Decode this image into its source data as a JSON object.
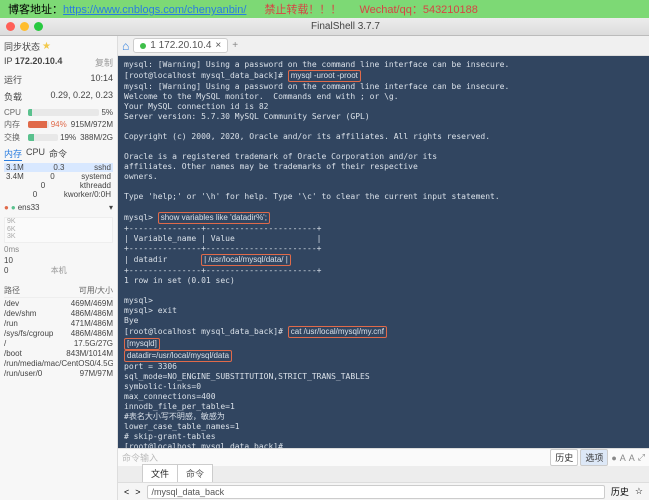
{
  "banner": {
    "blog_label": "博客地址：",
    "blog_url": "https://www.cnblogs.com/chenyanbin/",
    "warn": "禁止转载！！！",
    "contact_label": "Wechat/qq：",
    "contact_id": "543210188"
  },
  "title": "FinalShell 3.7.7",
  "sidebar": {
    "status_label": "同步状态",
    "ip_label": "IP",
    "ip": "172.20.10.4",
    "copy": "复制",
    "uptime_label": "运行",
    "uptime": "10:14",
    "load_label": "负载",
    "load": "0.29, 0.22, 0.23",
    "cpu_label": "CPU",
    "cpu_pct": "5%",
    "mem_label": "内存",
    "mem_pct": "94%",
    "mem_val": "915M/972M",
    "swap_label": "交换",
    "swap_pct": "19%",
    "swap_val": "388M/2G",
    "tabs": [
      "内存",
      "CPU",
      "命令"
    ],
    "procs": [
      {
        "mem": "3.1M",
        "pct": "0.3",
        "name": "sshd"
      },
      {
        "mem": "3.4M",
        "pct": "0",
        "name": "systemd"
      },
      {
        "mem": "",
        "pct": "0",
        "name": "kthreadd"
      },
      {
        "mem": "",
        "pct": "0",
        "name": "kworker/0:0H"
      }
    ],
    "net_iface": "ens33",
    "graph_y": [
      "9K",
      "9K",
      "6K",
      "3K"
    ],
    "graph_t": [
      "0ms",
      "10",
      "0"
    ],
    "local": "本机",
    "disk_header": [
      "路径",
      "可用/大小"
    ],
    "disks": [
      {
        "p": "/dev",
        "v": "469M/469M"
      },
      {
        "p": "/dev/shm",
        "v": "486M/486M"
      },
      {
        "p": "/run",
        "v": "471M/486M"
      },
      {
        "p": "/sys/fs/cgroup",
        "v": "486M/486M"
      },
      {
        "p": "/",
        "v": "17.5G/27G"
      },
      {
        "p": "/boot",
        "v": "843M/1014M"
      },
      {
        "p": "/run/media/mac/CentOS",
        "v": "0/4.5G"
      },
      {
        "p": "/run/user/0",
        "v": "97M/97M"
      }
    ]
  },
  "tab": {
    "bullet": true,
    "label": "1 172.20.10.4",
    "close": "×"
  },
  "terminal": {
    "lines": [
      "mysql: [Warning] Using a password on the command line interface can be insecure.",
      "[root@localhost mysql_data_back]# ",
      "mysql -uroot -proot",
      "mysql: [Warning] Using a password on the command line interface can be insecure.",
      "Welcome to the MySQL monitor.  Commands end with ; or \\g.",
      "Your MySQL connection id is 82",
      "Server version: 5.7.30 MySQL Community Server (GPL)",
      "",
      "Copyright (c) 2000, 2020, Oracle and/or its affiliates. All rights reserved.",
      "",
      "Oracle is a registered trademark of Oracle Corporation and/or its",
      "affiliates. Other names may be trademarks of their respective",
      "owners.",
      "",
      "Type 'help;' or '\\h' for help. Type '\\c' to clear the current input statement.",
      "",
      "mysql> ",
      "show variables like 'datadir%';",
      "+---------------+-----------------------+",
      "| Variable_name | Value                 |",
      "+---------------+-----------------------+",
      "| datadir       ",
      "| /usr/local/mysql/data/ |",
      "+---------------+-----------------------+",
      "1 row in set (0.01 sec)",
      "",
      "mysql> ",
      "mysql> exit",
      "Bye",
      "[root@localhost mysql_data_back]# ",
      "cat /usr/local/mysql/my.cnf",
      "[mysqld]",
      "datadir=/usr/local/mysql/data",
      "port = 3306",
      "sql_mode=NO_ENGINE_SUBSTITUTION,STRICT_TRANS_TABLES",
      "symbolic-links=0",
      "max_connections=400",
      "innodb_file_per_table=1",
      "#表名大小写不明感，敏感为",
      "lower_case_table_names=1",
      "# skip-grant-tables",
      "[root@localhost mysql_data_back]# "
    ]
  },
  "input": {
    "placeholder": "命令输入",
    "history": "历史",
    "select": "选项",
    "icons": [
      "●",
      "A",
      "A",
      "⤢"
    ]
  },
  "filetabs": [
    "文件",
    "命令"
  ],
  "filenav": {
    "back": "<",
    "fwd": ">",
    "path": "/mysql_data_back",
    "history": "历史",
    "bm": "☆"
  }
}
